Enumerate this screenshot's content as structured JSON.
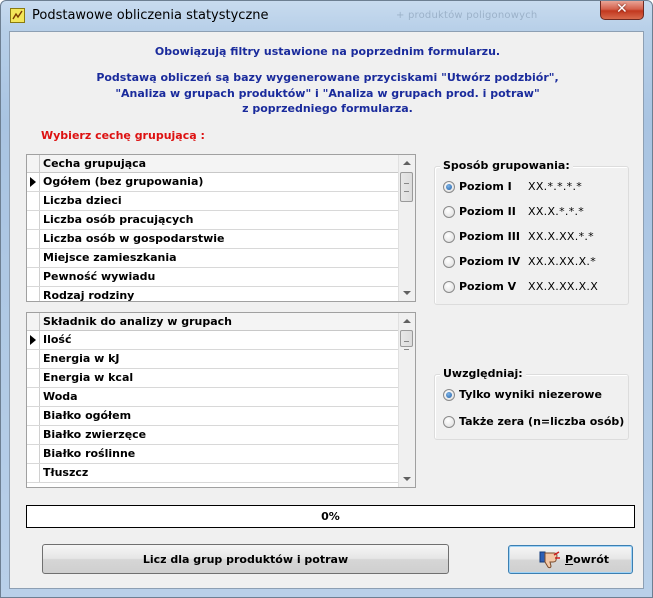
{
  "window": {
    "title": "Podstawowe obliczenia statystyczne",
    "background_title": "+ produktów poligonowych",
    "close_label": "✕"
  },
  "info": {
    "filters_note": "Obowiązują filtry ustawione na poprzednim formularzu.",
    "basis_lines": [
      "Podstawą obliczeń są bazy wygenerowane przyciskami \"Utwórz podzbiór\",",
      "\"Analiza w grupach produktów\" i \"Analiza w grupach prod. i potraw\"",
      "z poprzedniego formularza."
    ]
  },
  "grouping_heading": "Wybierz cechę grupującą :",
  "grid_grouping": {
    "header": "Cecha grupująca",
    "rows": [
      "Ogółem (bez grupowania)",
      "Liczba dzieci",
      "Liczba osób pracujących",
      "Liczba osób w gospodarstwie",
      "Miejsce zamieszkania",
      "Pewność wywiadu",
      "Rodzaj rodziny"
    ],
    "current_row": 0
  },
  "grid_components": {
    "header": "Składnik do analizy w grupach",
    "rows": [
      "Ilość",
      "Energia w kJ",
      "Energia w kcal",
      "Woda",
      "Białko ogółem",
      "Białko zwierzęce",
      "Białko roślinne",
      "Tłuszcz"
    ],
    "current_row": 0
  },
  "grouping_method": {
    "title": "Sposób grupowania:",
    "options": [
      {
        "label": "Poziom I",
        "code": "XX.*.*.*.*",
        "checked": true
      },
      {
        "label": "Poziom II",
        "code": "XX.X.*.*.*",
        "checked": false
      },
      {
        "label": "Poziom III",
        "code": "XX.X.XX.*.*",
        "checked": false
      },
      {
        "label": "Poziom IV",
        "code": "XX.X.XX.X.*",
        "checked": false
      },
      {
        "label": "Poziom V",
        "code": "XX.X.XX.X.X",
        "checked": false
      }
    ]
  },
  "include": {
    "title": "Uwzględniaj:",
    "options": [
      {
        "label": "Tylko wyniki niezerowe",
        "checked": true
      },
      {
        "label": "Także zera (n=liczba osób)",
        "checked": false
      }
    ]
  },
  "progress": {
    "value_percent": 0,
    "text": "0%",
    "fill_color": "#3a78c6"
  },
  "buttons": {
    "calculate_label": "Licz dla grup produktów i potraw",
    "back_label": "Powrót",
    "back_icon": "thumbs-down-icon"
  },
  "colors": {
    "info_text": "#1a2b9c",
    "heading_red": "#dd1010",
    "close_red": "#c2381f"
  }
}
